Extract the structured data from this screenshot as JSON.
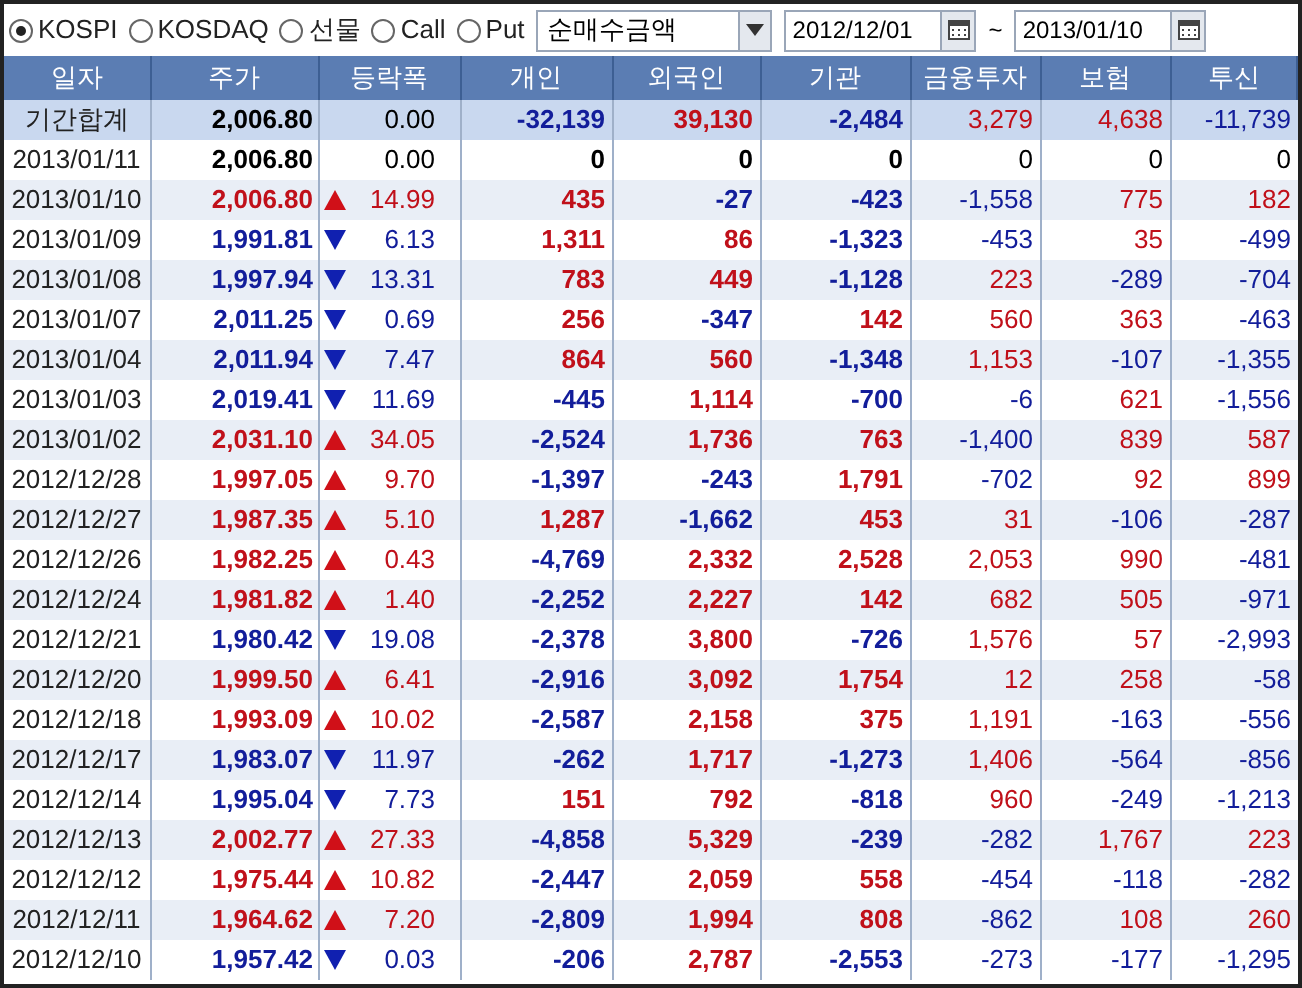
{
  "toolbar": {
    "markets": [
      {
        "label": "KOSPI",
        "selected": true
      },
      {
        "label": "KOSDAQ",
        "selected": false
      },
      {
        "label": "선물",
        "selected": false
      },
      {
        "label": "Call",
        "selected": false
      },
      {
        "label": "Put",
        "selected": false
      }
    ],
    "metric": {
      "value": "순매수금액"
    },
    "date_from": {
      "value": "2012/12/01"
    },
    "date_separator": "~",
    "date_to": {
      "value": "2013/01/10"
    }
  },
  "table": {
    "columns": [
      "일자",
      "주가",
      "등락폭",
      "개인",
      "외국인",
      "기관",
      "금융투자",
      "보험",
      "투신"
    ],
    "rows": [
      {
        "kind": "total",
        "date": "기간합계",
        "price": "2,006.80",
        "change": "0.00",
        "rise": false,
        "fall": false,
        "flows": [
          {
            "text": "-32,139",
            "color": "#121d9a"
          },
          {
            "text": "39,130",
            "color": "#c0101a"
          },
          {
            "text": "-2,484",
            "color": "#121d9a"
          },
          {
            "text": "3,279",
            "color": "#c0101a"
          },
          {
            "text": "4,638",
            "color": "#c0101a"
          },
          {
            "text": "-11,739",
            "color": "#121d9a"
          }
        ]
      },
      {
        "kind": "day",
        "date": "2013/01/11",
        "price": "2,006.80",
        "change": "0.00",
        "rise": false,
        "fall": false,
        "flows": [
          {
            "text": "0",
            "color": "#000000"
          },
          {
            "text": "0",
            "color": "#000000"
          },
          {
            "text": "0",
            "color": "#000000"
          },
          {
            "text": "0",
            "color": "#000000"
          },
          {
            "text": "0",
            "color": "#000000"
          },
          {
            "text": "0",
            "color": "#000000"
          }
        ]
      },
      {
        "kind": "day",
        "date": "2013/01/10",
        "price": "2,006.80",
        "change": "14.99",
        "rise": true,
        "fall": false,
        "flows": [
          {
            "text": "435",
            "color": "#c0101a"
          },
          {
            "text": "-27",
            "color": "#121d9a"
          },
          {
            "text": "-423",
            "color": "#121d9a"
          },
          {
            "text": "-1,558",
            "color": "#121d9a"
          },
          {
            "text": "775",
            "color": "#c0101a"
          },
          {
            "text": "182",
            "color": "#c0101a"
          }
        ]
      },
      {
        "kind": "day",
        "date": "2013/01/09",
        "price": "1,991.81",
        "change": "6.13",
        "rise": false,
        "fall": true,
        "flows": [
          {
            "text": "1,311",
            "color": "#c0101a"
          },
          {
            "text": "86",
            "color": "#c0101a"
          },
          {
            "text": "-1,323",
            "color": "#121d9a"
          },
          {
            "text": "-453",
            "color": "#121d9a"
          },
          {
            "text": "35",
            "color": "#c0101a"
          },
          {
            "text": "-499",
            "color": "#121d9a"
          }
        ]
      },
      {
        "kind": "day",
        "date": "2013/01/08",
        "price": "1,997.94",
        "change": "13.31",
        "rise": false,
        "fall": true,
        "flows": [
          {
            "text": "783",
            "color": "#c0101a"
          },
          {
            "text": "449",
            "color": "#c0101a"
          },
          {
            "text": "-1,128",
            "color": "#121d9a"
          },
          {
            "text": "223",
            "color": "#c0101a"
          },
          {
            "text": "-289",
            "color": "#121d9a"
          },
          {
            "text": "-704",
            "color": "#121d9a"
          }
        ]
      },
      {
        "kind": "day",
        "date": "2013/01/07",
        "price": "2,011.25",
        "change": "0.69",
        "rise": false,
        "fall": true,
        "flows": [
          {
            "text": "256",
            "color": "#c0101a"
          },
          {
            "text": "-347",
            "color": "#121d9a"
          },
          {
            "text": "142",
            "color": "#c0101a"
          },
          {
            "text": "560",
            "color": "#c0101a"
          },
          {
            "text": "363",
            "color": "#c0101a"
          },
          {
            "text": "-463",
            "color": "#121d9a"
          }
        ]
      },
      {
        "kind": "day",
        "date": "2013/01/04",
        "price": "2,011.94",
        "change": "7.47",
        "rise": false,
        "fall": true,
        "flows": [
          {
            "text": "864",
            "color": "#c0101a"
          },
          {
            "text": "560",
            "color": "#c0101a"
          },
          {
            "text": "-1,348",
            "color": "#121d9a"
          },
          {
            "text": "1,153",
            "color": "#c0101a"
          },
          {
            "text": "-107",
            "color": "#121d9a"
          },
          {
            "text": "-1,355",
            "color": "#121d9a"
          }
        ]
      },
      {
        "kind": "day",
        "date": "2013/01/03",
        "price": "2,019.41",
        "change": "11.69",
        "rise": false,
        "fall": true,
        "flows": [
          {
            "text": "-445",
            "color": "#121d9a"
          },
          {
            "text": "1,114",
            "color": "#c0101a"
          },
          {
            "text": "-700",
            "color": "#121d9a"
          },
          {
            "text": "-6",
            "color": "#121d9a"
          },
          {
            "text": "621",
            "color": "#c0101a"
          },
          {
            "text": "-1,556",
            "color": "#121d9a"
          }
        ]
      },
      {
        "kind": "day",
        "date": "2013/01/02",
        "price": "2,031.10",
        "change": "34.05",
        "rise": true,
        "fall": false,
        "flows": [
          {
            "text": "-2,524",
            "color": "#121d9a"
          },
          {
            "text": "1,736",
            "color": "#c0101a"
          },
          {
            "text": "763",
            "color": "#c0101a"
          },
          {
            "text": "-1,400",
            "color": "#121d9a"
          },
          {
            "text": "839",
            "color": "#c0101a"
          },
          {
            "text": "587",
            "color": "#c0101a"
          }
        ]
      },
      {
        "kind": "day",
        "date": "2012/12/28",
        "price": "1,997.05",
        "change": "9.70",
        "rise": true,
        "fall": false,
        "flows": [
          {
            "text": "-1,397",
            "color": "#121d9a"
          },
          {
            "text": "-243",
            "color": "#121d9a"
          },
          {
            "text": "1,791",
            "color": "#c0101a"
          },
          {
            "text": "-702",
            "color": "#121d9a"
          },
          {
            "text": "92",
            "color": "#c0101a"
          },
          {
            "text": "899",
            "color": "#c0101a"
          }
        ]
      },
      {
        "kind": "day",
        "date": "2012/12/27",
        "price": "1,987.35",
        "change": "5.10",
        "rise": true,
        "fall": false,
        "flows": [
          {
            "text": "1,287",
            "color": "#c0101a"
          },
          {
            "text": "-1,662",
            "color": "#121d9a"
          },
          {
            "text": "453",
            "color": "#c0101a"
          },
          {
            "text": "31",
            "color": "#c0101a"
          },
          {
            "text": "-106",
            "color": "#121d9a"
          },
          {
            "text": "-287",
            "color": "#121d9a"
          }
        ]
      },
      {
        "kind": "day",
        "date": "2012/12/26",
        "price": "1,982.25",
        "change": "0.43",
        "rise": true,
        "fall": false,
        "flows": [
          {
            "text": "-4,769",
            "color": "#121d9a"
          },
          {
            "text": "2,332",
            "color": "#c0101a"
          },
          {
            "text": "2,528",
            "color": "#c0101a"
          },
          {
            "text": "2,053",
            "color": "#c0101a"
          },
          {
            "text": "990",
            "color": "#c0101a"
          },
          {
            "text": "-481",
            "color": "#121d9a"
          }
        ]
      },
      {
        "kind": "day",
        "date": "2012/12/24",
        "price": "1,981.82",
        "change": "1.40",
        "rise": true,
        "fall": false,
        "flows": [
          {
            "text": "-2,252",
            "color": "#121d9a"
          },
          {
            "text": "2,227",
            "color": "#c0101a"
          },
          {
            "text": "142",
            "color": "#c0101a"
          },
          {
            "text": "682",
            "color": "#c0101a"
          },
          {
            "text": "505",
            "color": "#c0101a"
          },
          {
            "text": "-971",
            "color": "#121d9a"
          }
        ]
      },
      {
        "kind": "day",
        "date": "2012/12/21",
        "price": "1,980.42",
        "change": "19.08",
        "rise": false,
        "fall": true,
        "flows": [
          {
            "text": "-2,378",
            "color": "#121d9a"
          },
          {
            "text": "3,800",
            "color": "#c0101a"
          },
          {
            "text": "-726",
            "color": "#121d9a"
          },
          {
            "text": "1,576",
            "color": "#c0101a"
          },
          {
            "text": "57",
            "color": "#c0101a"
          },
          {
            "text": "-2,993",
            "color": "#121d9a"
          }
        ]
      },
      {
        "kind": "day",
        "date": "2012/12/20",
        "price": "1,999.50",
        "change": "6.41",
        "rise": true,
        "fall": false,
        "flows": [
          {
            "text": "-2,916",
            "color": "#121d9a"
          },
          {
            "text": "3,092",
            "color": "#c0101a"
          },
          {
            "text": "1,754",
            "color": "#c0101a"
          },
          {
            "text": "12",
            "color": "#c0101a"
          },
          {
            "text": "258",
            "color": "#c0101a"
          },
          {
            "text": "-58",
            "color": "#121d9a"
          }
        ]
      },
      {
        "kind": "day",
        "date": "2012/12/18",
        "price": "1,993.09",
        "change": "10.02",
        "rise": true,
        "fall": false,
        "flows": [
          {
            "text": "-2,587",
            "color": "#121d9a"
          },
          {
            "text": "2,158",
            "color": "#c0101a"
          },
          {
            "text": "375",
            "color": "#c0101a"
          },
          {
            "text": "1,191",
            "color": "#c0101a"
          },
          {
            "text": "-163",
            "color": "#121d9a"
          },
          {
            "text": "-556",
            "color": "#121d9a"
          }
        ]
      },
      {
        "kind": "day",
        "date": "2012/12/17",
        "price": "1,983.07",
        "change": "11.97",
        "rise": false,
        "fall": true,
        "flows": [
          {
            "text": "-262",
            "color": "#121d9a"
          },
          {
            "text": "1,717",
            "color": "#c0101a"
          },
          {
            "text": "-1,273",
            "color": "#121d9a"
          },
          {
            "text": "1,406",
            "color": "#c0101a"
          },
          {
            "text": "-564",
            "color": "#121d9a"
          },
          {
            "text": "-856",
            "color": "#121d9a"
          }
        ]
      },
      {
        "kind": "day",
        "date": "2012/12/14",
        "price": "1,995.04",
        "change": "7.73",
        "rise": false,
        "fall": true,
        "flows": [
          {
            "text": "151",
            "color": "#c0101a"
          },
          {
            "text": "792",
            "color": "#c0101a"
          },
          {
            "text": "-818",
            "color": "#121d9a"
          },
          {
            "text": "960",
            "color": "#c0101a"
          },
          {
            "text": "-249",
            "color": "#121d9a"
          },
          {
            "text": "-1,213",
            "color": "#121d9a"
          }
        ]
      },
      {
        "kind": "day",
        "date": "2012/12/13",
        "price": "2,002.77",
        "change": "27.33",
        "rise": true,
        "fall": false,
        "flows": [
          {
            "text": "-4,858",
            "color": "#121d9a"
          },
          {
            "text": "5,329",
            "color": "#c0101a"
          },
          {
            "text": "-239",
            "color": "#121d9a"
          },
          {
            "text": "-282",
            "color": "#121d9a"
          },
          {
            "text": "1,767",
            "color": "#c0101a"
          },
          {
            "text": "223",
            "color": "#c0101a"
          }
        ]
      },
      {
        "kind": "day",
        "date": "2012/12/12",
        "price": "1,975.44",
        "change": "10.82",
        "rise": true,
        "fall": false,
        "flows": [
          {
            "text": "-2,447",
            "color": "#121d9a"
          },
          {
            "text": "2,059",
            "color": "#c0101a"
          },
          {
            "text": "558",
            "color": "#c0101a"
          },
          {
            "text": "-454",
            "color": "#121d9a"
          },
          {
            "text": "-118",
            "color": "#121d9a"
          },
          {
            "text": "-282",
            "color": "#121d9a"
          }
        ]
      },
      {
        "kind": "day",
        "date": "2012/12/11",
        "price": "1,964.62",
        "change": "7.20",
        "rise": true,
        "fall": false,
        "flows": [
          {
            "text": "-2,809",
            "color": "#121d9a"
          },
          {
            "text": "1,994",
            "color": "#c0101a"
          },
          {
            "text": "808",
            "color": "#c0101a"
          },
          {
            "text": "-862",
            "color": "#121d9a"
          },
          {
            "text": "108",
            "color": "#c0101a"
          },
          {
            "text": "260",
            "color": "#c0101a"
          }
        ]
      },
      {
        "kind": "day",
        "date": "2012/12/10",
        "price": "1,957.42",
        "change": "0.03",
        "rise": false,
        "fall": true,
        "flows": [
          {
            "text": "-206",
            "color": "#121d9a"
          },
          {
            "text": "2,787",
            "color": "#c0101a"
          },
          {
            "text": "-2,553",
            "color": "#121d9a"
          },
          {
            "text": "-273",
            "color": "#121d9a"
          },
          {
            "text": "-177",
            "color": "#121d9a"
          },
          {
            "text": "-1,295",
            "color": "#121d9a"
          }
        ]
      }
    ]
  }
}
